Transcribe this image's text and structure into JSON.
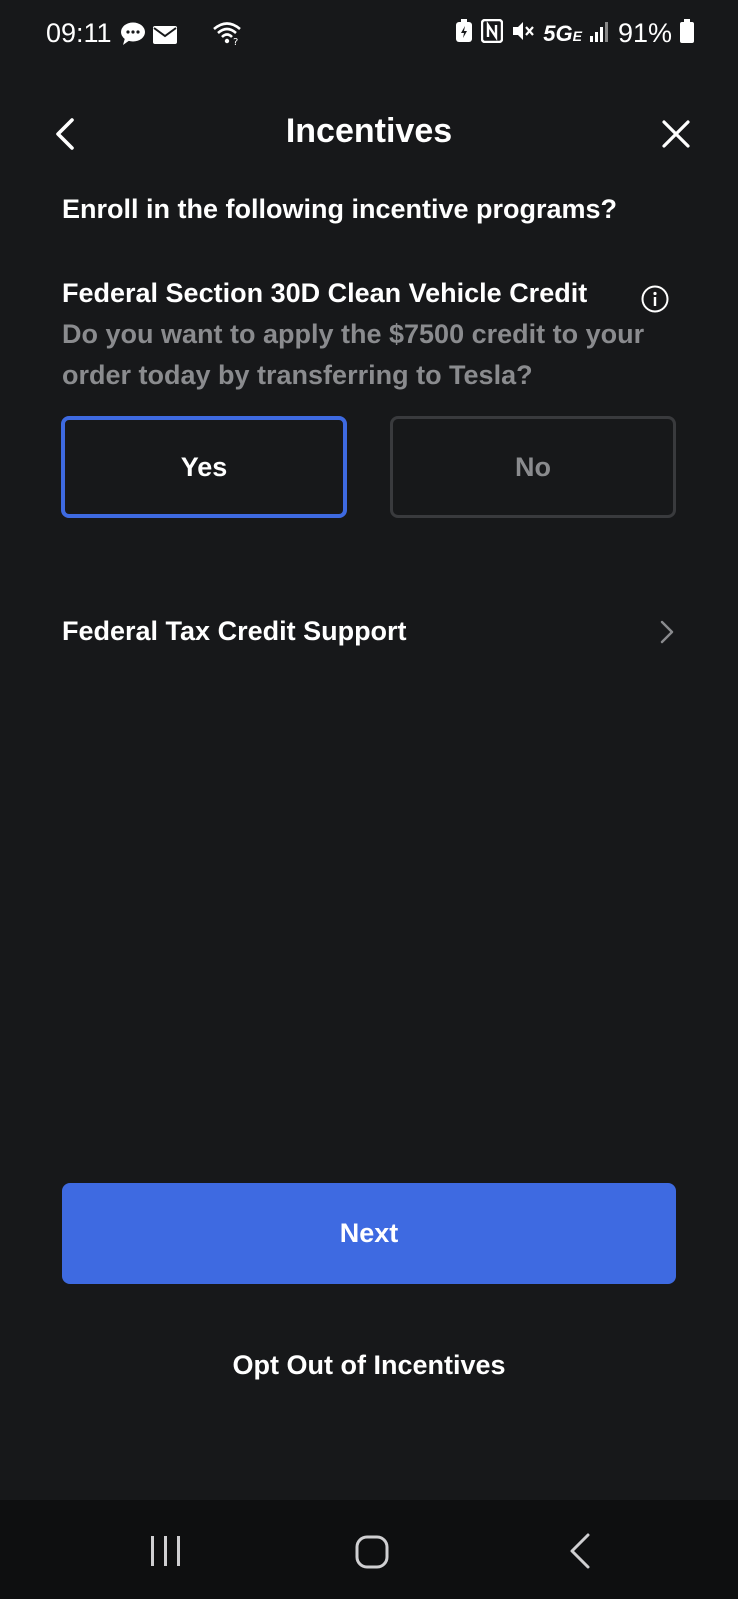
{
  "status_bar": {
    "time": "09:11",
    "network": "5G",
    "network_suffix": "E",
    "battery": "91%",
    "icons": [
      "chat-icon",
      "mail-icon",
      "wifi-icon",
      "battery-saver-icon",
      "nfc-icon",
      "mute-icon",
      "signal-icon",
      "battery-icon"
    ]
  },
  "header": {
    "title": "Incentives",
    "back_icon": "chevron-left-icon",
    "close_icon": "close-icon"
  },
  "enroll_question": "Enroll in the following incentive programs?",
  "program": {
    "title": "Federal Section 30D Clean Vehicle Credit",
    "info_icon": "info-icon",
    "description": "Do you want to apply the $7500 credit to your order today by transferring to Tesla?",
    "options": [
      {
        "label": "Yes",
        "selected": true
      },
      {
        "label": "No",
        "selected": false
      }
    ]
  },
  "support_link": {
    "label": "Federal Tax Credit Support",
    "icon": "chevron-right-icon"
  },
  "actions": {
    "next_label": "Next",
    "opt_out_label": "Opt Out of Incentives"
  },
  "nav_bar": {
    "icons": [
      "recents-icon",
      "home-icon",
      "back-icon"
    ]
  },
  "colors": {
    "background": "#17181a",
    "accent": "#3e6ae1",
    "muted_text": "#8a8b8e",
    "nav_bar": "#0e0f10"
  }
}
